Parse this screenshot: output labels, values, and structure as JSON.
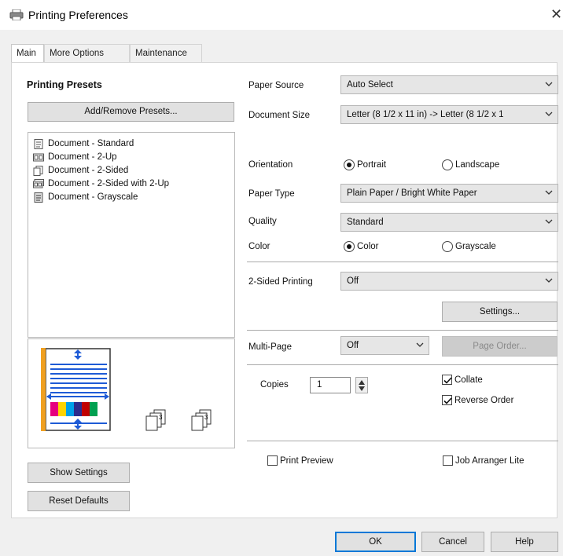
{
  "window": {
    "title": "Printing Preferences",
    "close_glyph": "✕"
  },
  "tabs": [
    {
      "label": "Main",
      "active": true
    },
    {
      "label": "More Options",
      "active": false
    },
    {
      "label": "Maintenance",
      "active": false
    }
  ],
  "presets": {
    "heading": "Printing Presets",
    "add_remove_button": "Add/Remove Presets...",
    "items": [
      {
        "label": "Document - Standard",
        "icon": "document-standard-icon"
      },
      {
        "label": "Document - 2-Up",
        "icon": "document-2up-icon"
      },
      {
        "label": "Document - 2-Sided",
        "icon": "document-2sided-icon"
      },
      {
        "label": "Document - 2-Sided with 2-Up",
        "icon": "document-2sided-2up-icon"
      },
      {
        "label": "Document - Grayscale",
        "icon": "document-grayscale-icon"
      }
    ]
  },
  "settings": {
    "paper_source": {
      "label": "Paper Source",
      "value": "Auto Select"
    },
    "document_size": {
      "label": "Document Size",
      "value": "Letter (8 1/2 x 11 in) -> Letter (8 1/2 x 1"
    },
    "orientation": {
      "label": "Orientation",
      "options": [
        "Portrait",
        "Landscape"
      ],
      "selected": "Portrait"
    },
    "paper_type": {
      "label": "Paper Type",
      "value": "Plain Paper / Bright White Paper"
    },
    "quality": {
      "label": "Quality",
      "value": "Standard"
    },
    "color": {
      "label": "Color",
      "options": [
        "Color",
        "Grayscale"
      ],
      "selected": "Color"
    },
    "two_sided": {
      "label": "2-Sided Printing",
      "value": "Off",
      "settings_button": "Settings..."
    },
    "multi_page": {
      "label": "Multi-Page",
      "value": "Off",
      "page_order_button": "Page Order..."
    },
    "copies": {
      "label": "Copies",
      "value": "1"
    },
    "collate": {
      "label": "Collate",
      "checked": true
    },
    "reverse_order": {
      "label": "Reverse Order",
      "checked": true
    },
    "print_preview": {
      "label": "Print Preview",
      "checked": false
    },
    "job_arranger": {
      "label": "Job Arranger Lite",
      "checked": false
    }
  },
  "left_buttons": {
    "show_settings": "Show Settings",
    "reset_defaults": "Reset Defaults"
  },
  "footer": {
    "ok": "OK",
    "cancel": "Cancel",
    "help": "Help"
  },
  "colors": {
    "accent": "#0078d7",
    "select_bg": "#e6e6e6",
    "disabled_btn": "#cccccc"
  }
}
